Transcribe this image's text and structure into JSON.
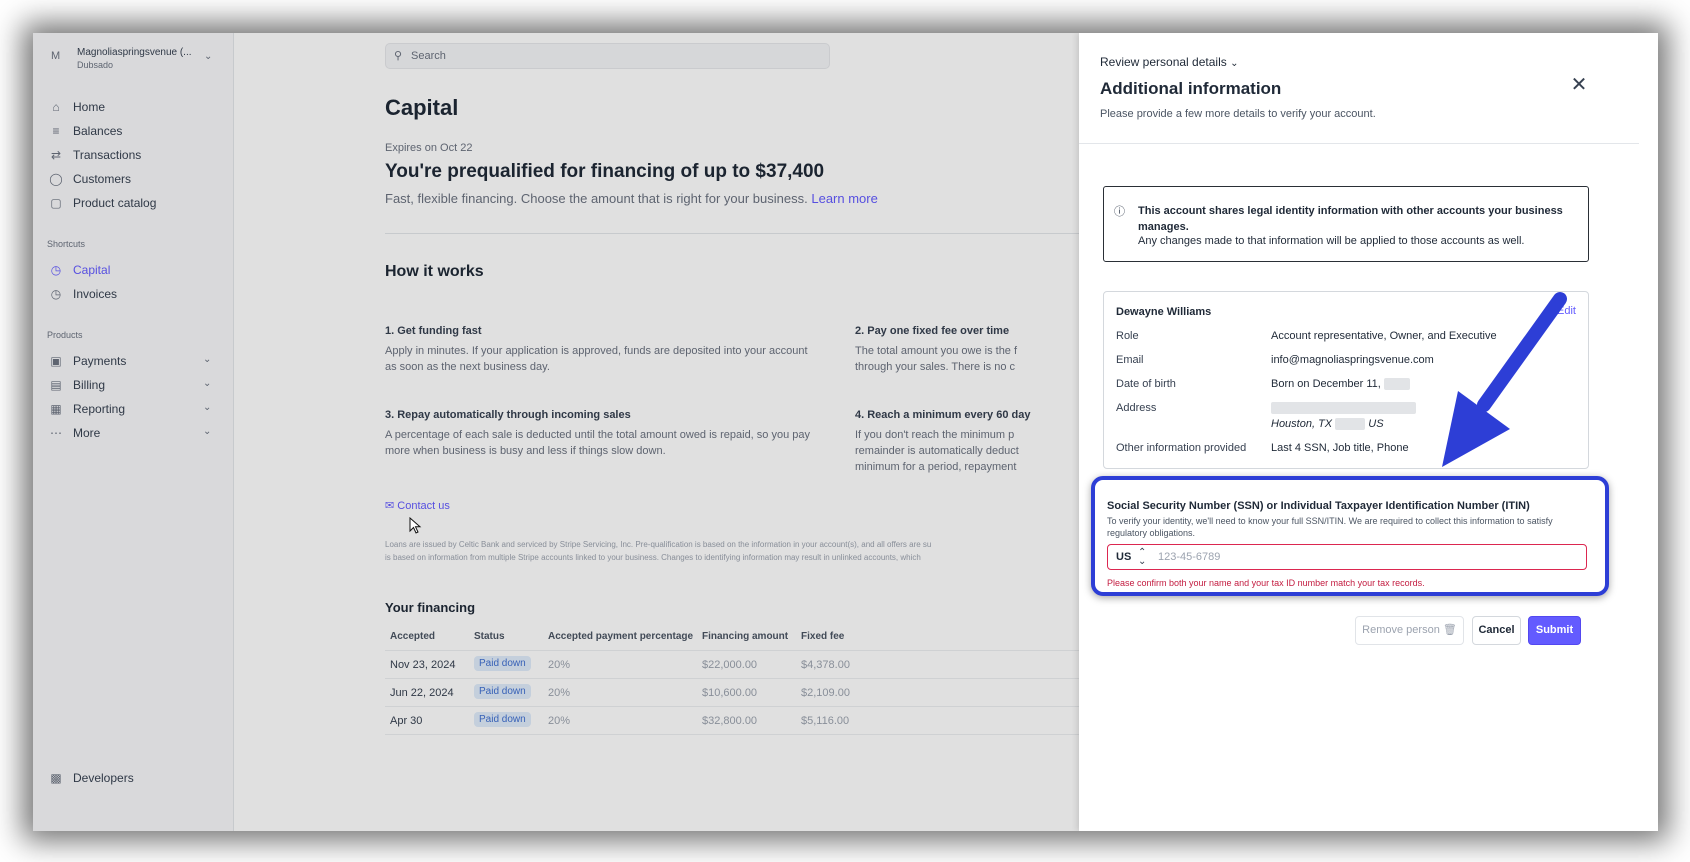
{
  "sidebar": {
    "account_initial": "M",
    "account_name": "Magnoliaspringsvenue (...",
    "account_sub": "Dubsado",
    "nav": [
      {
        "label": "Home",
        "icon": "home-icon"
      },
      {
        "label": "Balances",
        "icon": "balances-icon"
      },
      {
        "label": "Transactions",
        "icon": "transactions-icon"
      },
      {
        "label": "Customers",
        "icon": "customers-icon"
      },
      {
        "label": "Product catalog",
        "icon": "box-icon"
      }
    ],
    "shortcuts_label": "Shortcuts",
    "shortcuts": [
      {
        "label": "Capital",
        "icon": "clock-icon",
        "active": true
      },
      {
        "label": "Invoices",
        "icon": "clock-icon"
      }
    ],
    "products_label": "Products",
    "products": [
      {
        "label": "Payments",
        "icon": "payments-icon"
      },
      {
        "label": "Billing",
        "icon": "billing-icon"
      },
      {
        "label": "Reporting",
        "icon": "reporting-icon"
      },
      {
        "label": "More",
        "icon": "more-icon"
      }
    ],
    "developers": "Developers"
  },
  "main": {
    "search_placeholder": "Search",
    "title": "Capital",
    "expires": "Expires on Oct 22",
    "headline": "You're prequalified for financing of up to $37,400",
    "subline": "Fast, flexible financing. Choose the amount that is right for your business.",
    "learn_more": "Learn more",
    "how_it_works": "How it works",
    "steps": [
      {
        "title": "1. Get funding fast",
        "desc1": "Apply in minutes. If your application is approved, funds are deposited into your account",
        "desc2": "as soon as the next business day.",
        "desc3": ""
      },
      {
        "title": "2. Pay one fixed fee over time",
        "desc1": "The total amount you owe is the f",
        "desc2": "through your sales. There is no c",
        "desc3": ""
      },
      {
        "title": "3. Repay automatically through incoming sales",
        "desc1": "A percentage of each sale is deducted until the total amount owed is repaid, so you pay",
        "desc2": "more when business is busy and less if things slow down.",
        "desc3": ""
      },
      {
        "title": "4. Reach a minimum every 60 day",
        "desc1": "If you don't reach the minimum p",
        "desc2": "remainder is automatically deduct",
        "desc3": "minimum for a period, repayment"
      }
    ],
    "contact": "Contact us",
    "legal1": "Loans are issued by Celtic Bank and serviced by Stripe Servicing, Inc. Pre-qualification is based on the information in your account(s), and all offers are su",
    "legal2": "is based on information from multiple Stripe accounts linked to your business. Changes to identifying information may result in unlinked accounts, which",
    "your_financing": "Your financing",
    "table": {
      "headers": [
        "Accepted",
        "Status",
        "Accepted payment percentage",
        "Financing amount",
        "Fixed fee"
      ],
      "rows": [
        {
          "date": "Nov 23, 2024",
          "status": "Paid down",
          "pct": "20%",
          "amount": "$22,000.00",
          "fee": "$4,378.00"
        },
        {
          "date": "Jun 22, 2024",
          "status": "Paid down",
          "pct": "20%",
          "amount": "$10,600.00",
          "fee": "$2,109.00"
        },
        {
          "date": "Apr 30",
          "status": "Paid down",
          "pct": "20%",
          "amount": "$32,800.00",
          "fee": "$5,116.00"
        }
      ]
    }
  },
  "panel": {
    "breadcrumb": "Review personal details",
    "title": "Additional information",
    "description": "Please provide a few more details to verify your account.",
    "notice_bold": "This account shares legal identity information with other accounts your business manages.",
    "notice_text": "Any changes made to that information will be applied to those accounts as well.",
    "person": {
      "name": "Dewayne Williams",
      "edit": "Edit",
      "role_label": "Role",
      "role": "Account representative, Owner, and Executive",
      "email_label": "Email",
      "email": "info@magnoliaspringsvenue.com",
      "dob_label": "Date of birth",
      "dob": "Born on December 11,",
      "address_label": "Address",
      "address_city": "Houston, TX",
      "address_country": "US",
      "other_label": "Other information provided",
      "other": "Last 4 SSN, Job title, Phone"
    },
    "ssn": {
      "title": "Social Security Number (SSN) or Individual Taxpayer Identification Number (ITIN)",
      "desc": "To verify your identity, we'll need to know your full SSN/ITIN. We are required to collect this information to satisfy regulatory obligations.",
      "country": "US",
      "placeholder": "123-45-6789",
      "error": "Please confirm both your name and your tax ID number match your tax records."
    },
    "remove_person": "Remove person",
    "cancel": "Cancel",
    "submit": "Submit"
  },
  "colors": {
    "accent": "#635bff",
    "highlight": "#2d3ed6",
    "error": "#c31c40"
  }
}
